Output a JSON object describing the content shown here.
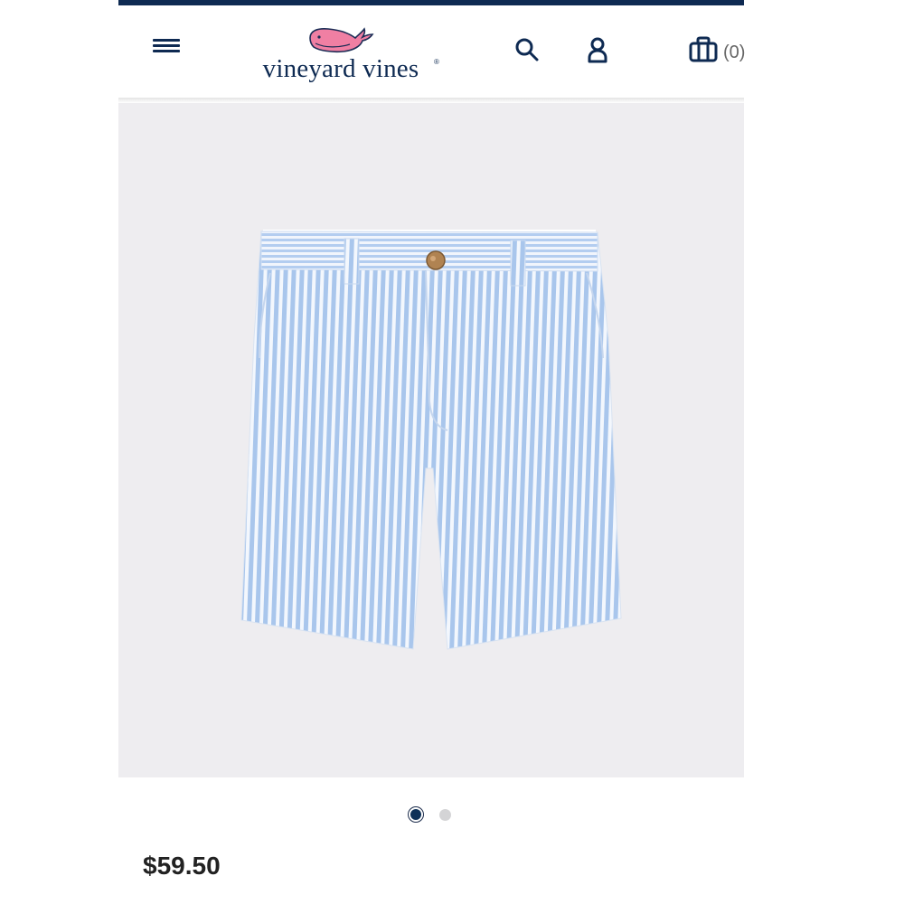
{
  "theme": {
    "navy": "#0e2a52",
    "whale_pink": "#f07fa3",
    "image_bg": "#eeedf0",
    "text": "#222222"
  },
  "header": {
    "menu_icon": "hamburger-icon",
    "logo_text": "vineyard vines",
    "logo_mark": "®",
    "search_icon": "search-icon",
    "account_icon": "user-icon",
    "bag_icon": "shopping-bag-icon",
    "bag_count": "(0)"
  },
  "product": {
    "image_subject": "light blue seersucker shorts",
    "carousel": {
      "total": 2,
      "active": 1
    },
    "price": "$59.50"
  }
}
